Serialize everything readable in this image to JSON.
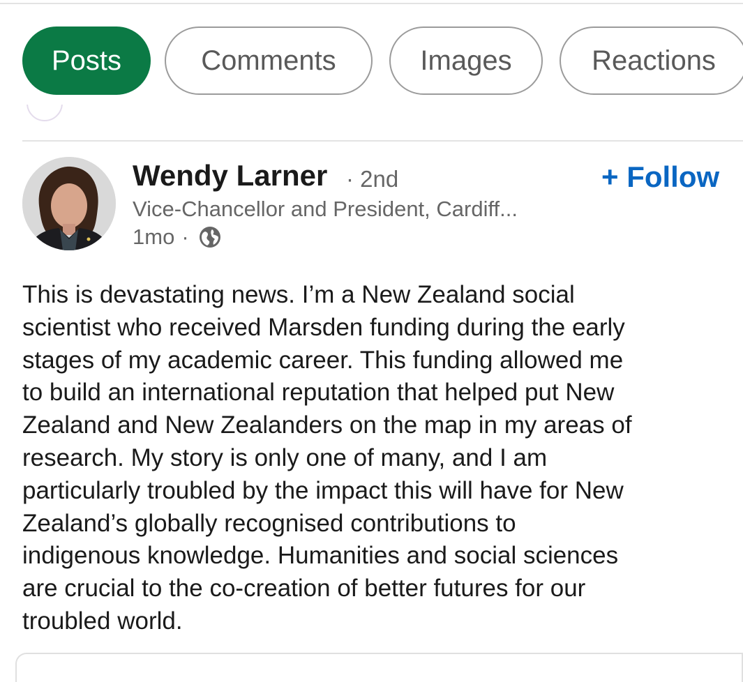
{
  "tabs": [
    {
      "label": "Posts",
      "active": true
    },
    {
      "label": "Comments",
      "active": false
    },
    {
      "label": "Images",
      "active": false
    },
    {
      "label": "Reactions",
      "active": false
    }
  ],
  "post": {
    "author": {
      "name": "Wendy Larner",
      "degree": "2nd",
      "headline": "Vice-Chancellor and President, Cardiff...",
      "time": "1mo",
      "visibility_icon": "globe-icon"
    },
    "follow_label": "+ Follow",
    "body_lines": [
      "This is devastating news.  I’m a New Zealand social",
      "scientist who received Marsden funding during the early",
      "stages of my academic career.  This funding allowed me",
      "to build an international reputation that helped put New",
      "Zealand and New Zealanders on the map in my areas of",
      "research.  My story is only one of many, and I am",
      "particularly troubled by the impact this will have for New",
      "Zealand’s globally recognised contributions to",
      "indigenous knowledge.  Humanities and social sciences",
      "are crucial to the co-creation of better futures for our",
      "troubled world."
    ]
  },
  "colors": {
    "active_tab": "#0b7a45",
    "follow": "#0a66c2",
    "secondary_text": "#666666"
  }
}
